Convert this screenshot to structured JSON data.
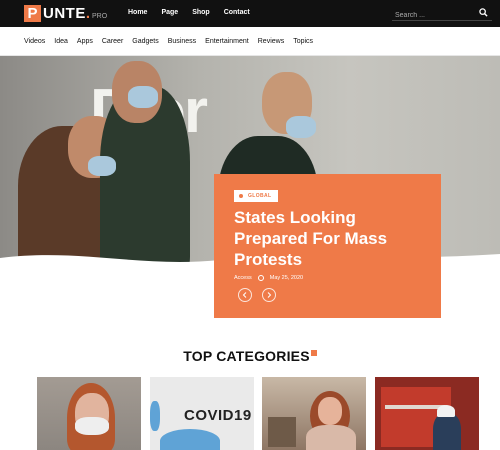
{
  "brand": {
    "logo_letter": "P",
    "name": "UNTE",
    "dot": ".",
    "suffix": "PRO",
    "accent": "#ef7a48"
  },
  "top_nav": {
    "items": [
      "Home",
      "Page",
      "Shop",
      "Contact"
    ]
  },
  "search": {
    "placeholder": "Search ..."
  },
  "category_nav": {
    "items": [
      "Videos",
      "Idea",
      "Apps",
      "Career",
      "Gadgets",
      "Business",
      "Entertainment",
      "Reviews",
      "Topics"
    ]
  },
  "hero": {
    "background_sign": "Dior",
    "badge": "GLOBAL",
    "title": "States Looking Prepared For Mass Protests",
    "author": "Access",
    "date": "May 25, 2020",
    "prev_icon": "chevron-left-icon",
    "next_icon": "chevron-right-icon"
  },
  "categories_section": {
    "title": "TOP CATEGORIES",
    "tiles": [
      {
        "name": "woman-mask"
      },
      {
        "name": "covid19-sign",
        "text": "COVID19"
      },
      {
        "name": "woman-home"
      },
      {
        "name": "workers-industrial"
      }
    ]
  }
}
